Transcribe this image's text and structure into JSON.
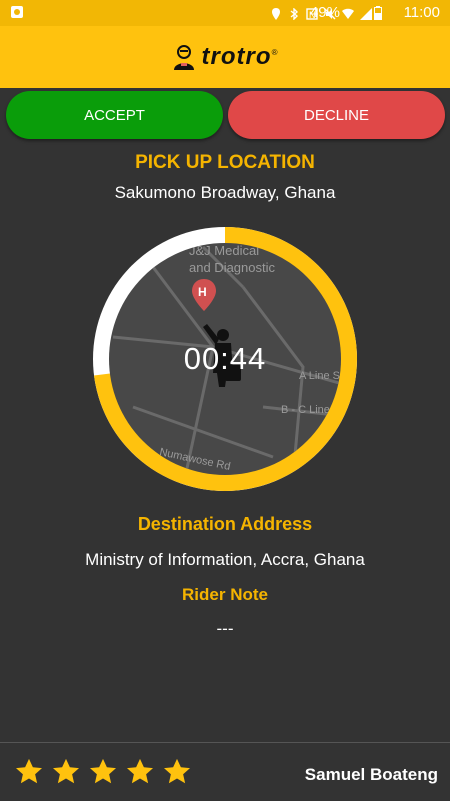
{
  "status_bar": {
    "battery": "49%",
    "time": "11:00",
    "icons": [
      "notification-icon",
      "location-icon",
      "bluetooth-icon",
      "nfc-icon",
      "mute-icon",
      "wifi-icon",
      "signal-icon",
      "battery-icon"
    ]
  },
  "app": {
    "logo_text": "trotro",
    "logo_mark": "®"
  },
  "actions": {
    "accept_label": "ACCEPT",
    "decline_label": "DECLINE"
  },
  "pickup": {
    "heading": "PICK UP LOCATION",
    "address": "Sakumono Broadway, Ghana"
  },
  "timer": {
    "value": "00:44",
    "progress_fraction": 0.73
  },
  "map": {
    "labels": [
      "J&J Medical",
      "and Diagnostic",
      "A Line St",
      "B - C Line",
      "Numawose Rd"
    ],
    "marker_letter": "H"
  },
  "destination": {
    "heading": "Destination Address",
    "address": "Ministry of Information, Accra, Ghana"
  },
  "rider_note": {
    "heading": "Rider Note",
    "text": "---"
  },
  "rider": {
    "name": "Samuel Boateng",
    "rating": 5
  },
  "colors": {
    "brand_yellow": "#ffc20e",
    "accept_green": "#0a9d0a",
    "decline_red": "#e04848",
    "background": "#333333"
  }
}
